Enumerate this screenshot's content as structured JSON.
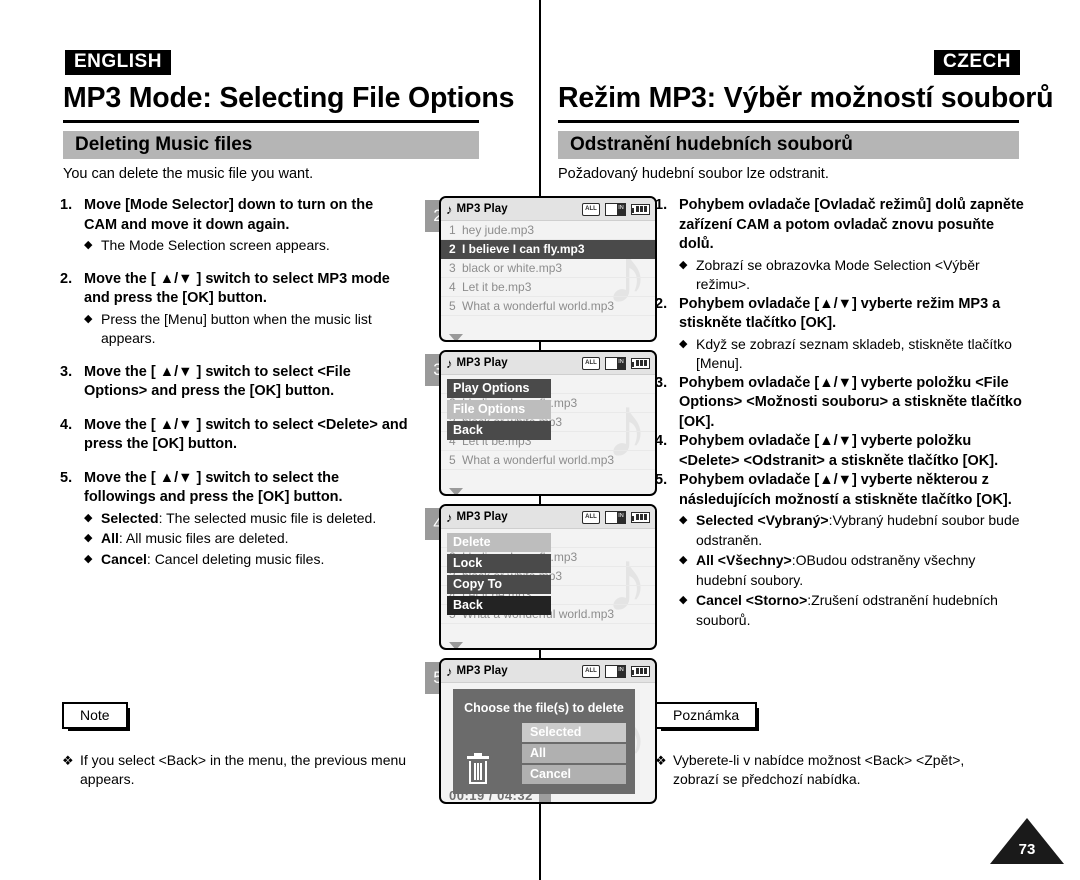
{
  "english": {
    "lang_tag": "ENGLISH",
    "title": "MP3 Mode: Selecting File Options",
    "section": "Deleting Music files",
    "intro": "You can delete the music file you want.",
    "steps": [
      {
        "num": "1.",
        "title": "Move [Mode Selector] down to turn on the CAM and move it down again.",
        "subs": [
          {
            "mark": "◆",
            "text": "The Mode Selection screen appears."
          }
        ]
      },
      {
        "num": "2.",
        "title": "Move the [ ▲/▼ ] switch to select MP3 mode and press the [OK] button.",
        "subs": [
          {
            "mark": "◆",
            "text": "Press the [Menu] button when the music list appears."
          }
        ]
      },
      {
        "num": "3.",
        "title": "Move the [ ▲/▼ ] switch to select <File Options> and press the [OK] button.",
        "subs": []
      },
      {
        "num": "4.",
        "title": "Move the [ ▲/▼ ] switch to select <Delete> and press the [OK] button.",
        "subs": []
      },
      {
        "num": "5.",
        "title": "Move the [ ▲/▼ ] switch to select the followings and press the [OK] button.",
        "subs": [
          {
            "mark": "◆",
            "bold": "Selected",
            "text": ": The selected music file is deleted."
          },
          {
            "mark": "◆",
            "bold": "All",
            "text": ": All music files are deleted."
          },
          {
            "mark": "◆",
            "bold": "Cancel",
            "text": ": Cancel deleting music files."
          }
        ]
      }
    ],
    "note_label": "Note",
    "note_mark": "❖",
    "note_text": "If you select <Back> in the menu, the previous menu appears."
  },
  "czech": {
    "lang_tag": "CZECH",
    "title": "Režim MP3: Výběr možností souborů",
    "section": "Odstranění hudebních souborů",
    "intro": "Požadovaný hudební soubor lze odstranit.",
    "steps": [
      {
        "num": "1.",
        "title": "Pohybem ovladače [Ovladač režimů] dolů zapněte zařízení CAM a potom ovladač znovu posuňte dolů.",
        "subs": [
          {
            "mark": "◆",
            "text": "Zobrazí se obrazovka Mode Selection <Výběr režimu>."
          }
        ]
      },
      {
        "num": "2.",
        "title": "Pohybem ovladače [▲/▼] vyberte režim MP3 a stiskněte tlačítko [OK].",
        "subs": [
          {
            "mark": "◆",
            "text": "Když se zobrazí seznam skladeb, stiskněte tlačítko [Menu]."
          }
        ]
      },
      {
        "num": "3.",
        "title": "Pohybem ovladače [▲/▼] vyberte položku <File Options> <Možnosti souboru> a stiskněte tlačítko [OK].",
        "subs": []
      },
      {
        "num": "4.",
        "title": "Pohybem ovladače [▲/▼] vyberte položku <Delete> <Odstranit> a stiskněte tlačítko [OK].",
        "subs": []
      },
      {
        "num": "5.",
        "title": "Pohybem ovladače [▲/▼] vyberte některou z následujících možností a stiskněte tlačítko [OK].",
        "subs": [
          {
            "mark": "◆",
            "bold": "Selected <Vybraný>",
            "text": ":Vybraný hudební soubor bude odstraněn."
          },
          {
            "mark": "◆",
            "bold": "All <Všechny>",
            "text": ":OBudou odstraněny všechny hudební soubory."
          },
          {
            "mark": "◆",
            "bold": "Cancel <Storno>",
            "text": ":Zrušení odstranění hudebních souborů."
          }
        ]
      }
    ],
    "note_label": "Poznámka",
    "note_mark": "❖",
    "note_text": "Vyberete-li v nabídce možnost <Back> <Zpět>, zobrazí se předchozí nabídka."
  },
  "screens": [
    {
      "badge": "2",
      "lcd_title": "MP3 Play",
      "note_icon": "music-note-icon",
      "icons": {
        "repeat": "ALL",
        "memory": "IN",
        "battery": "battery-full-icon"
      },
      "tracks": [
        {
          "idx": "1",
          "name": "hey jude.mp3",
          "selected": false
        },
        {
          "idx": "2",
          "name": "I believe I can fly.mp3",
          "selected": true
        },
        {
          "idx": "3",
          "name": "black or white.mp3",
          "selected": false
        },
        {
          "idx": "4",
          "name": "Let it be.mp3",
          "selected": false
        },
        {
          "idx": "5",
          "name": "What a wonderful world.mp3",
          "selected": false
        }
      ],
      "menu": [],
      "dialog": null
    },
    {
      "badge": "3",
      "lcd_title": "MP3 Play",
      "note_icon": "music-note-icon",
      "icons": {
        "repeat": "ALL",
        "memory": "IN",
        "battery": "battery-full-icon"
      },
      "tracks": [
        {
          "idx": "1",
          "name": "hey jude.mp3",
          "selected": false
        },
        {
          "idx": "2",
          "name": "I believe I can fly.mp3",
          "selected": false
        },
        {
          "idx": "3",
          "name": "black or white.mp3",
          "selected": false
        },
        {
          "idx": "4",
          "name": "Let it be.mp3",
          "selected": false
        },
        {
          "idx": "5",
          "name": "What a wonderful world.mp3",
          "selected": false
        }
      ],
      "menu": [
        {
          "label": "Play Options",
          "style": "dark"
        },
        {
          "label": "File Options",
          "style": "light"
        },
        {
          "label": "Back",
          "style": "dark"
        }
      ],
      "dialog": null
    },
    {
      "badge": "4",
      "lcd_title": "MP3 Play",
      "note_icon": "music-note-icon",
      "icons": {
        "repeat": "ALL",
        "memory": "IN",
        "battery": "battery-full-icon"
      },
      "tracks": [
        {
          "idx": "1",
          "name": "hey jude.mp3",
          "selected": false
        },
        {
          "idx": "2",
          "name": "I believe I can fly.mp3",
          "selected": false
        },
        {
          "idx": "3",
          "name": "black or white.mp3",
          "selected": false
        },
        {
          "idx": "4",
          "name": "Let it be.mp3",
          "selected": false
        },
        {
          "idx": "5",
          "name": "What a wonderful world.mp3",
          "selected": false
        }
      ],
      "menu": [
        {
          "label": "Delete",
          "style": "light"
        },
        {
          "label": "Lock",
          "style": "dark"
        },
        {
          "label": "Copy To",
          "style": "dark"
        },
        {
          "label": "Back",
          "style": "black"
        }
      ],
      "dialog": null
    },
    {
      "badge": "5",
      "lcd_title": "MP3 Play",
      "note_icon": "music-note-icon",
      "icons": {
        "repeat": "ALL",
        "memory": "IN",
        "battery": "battery-full-icon"
      },
      "tracks": [],
      "menu": [],
      "dialog": {
        "title": "Choose the file(s) to delete",
        "trash_icon": "trash-can-icon",
        "buttons": [
          {
            "label": "Selected",
            "active": true
          },
          {
            "label": "All",
            "active": false
          },
          {
            "label": "Cancel",
            "active": false
          }
        ],
        "time": "00:19 / 04:32"
      }
    }
  ],
  "page_number": "73"
}
